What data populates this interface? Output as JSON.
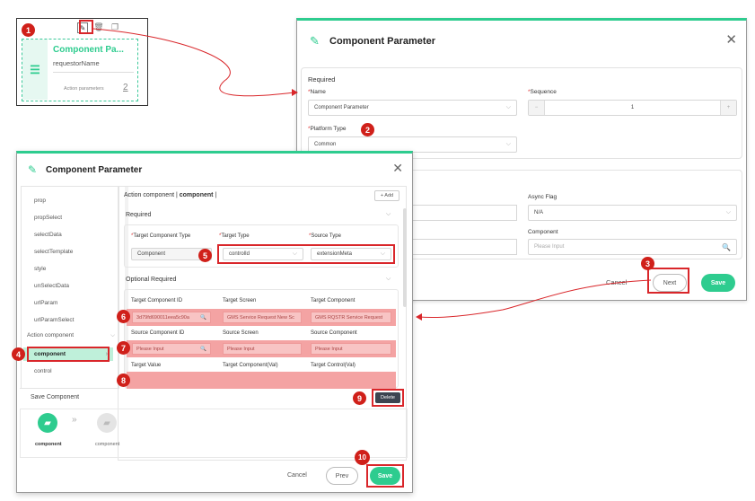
{
  "node_card": {
    "title": "Component Pa...",
    "subtitle": "requestorName",
    "footer": "Action parameters",
    "count": "2"
  },
  "dialog_back": {
    "title": "Component Parameter",
    "section_required": "Required",
    "name_label": "Name",
    "name_value": "Component Parameter",
    "sequence_label": "Sequence",
    "sequence_value": "1",
    "platform_label": "Platform Type",
    "platform_value": "Common",
    "async_label": "Async Flag",
    "async_value": "N/A",
    "component_label": "Component",
    "component_placeholder": "Please Input",
    "cancel": "Cancel",
    "next": "Next",
    "save": "Save"
  },
  "dialog_front": {
    "title": "Component Parameter",
    "menu": [
      "prop",
      "propSelect",
      "selectData",
      "selectTemplate",
      "style",
      "unSelectData",
      "urlParam",
      "urlParamSelect"
    ],
    "action_group": "Action component",
    "selected_item": "component",
    "control_item": "control",
    "save_component": "Save Component",
    "flow_from": "component",
    "flow_to": "component",
    "header_prefix": "Action component | ",
    "header_name": "component",
    "header_suffix": " |",
    "add": "+ Add",
    "required": "Required",
    "target_component_type_label": "Target Component Type",
    "target_component_type_value": "Component",
    "target_type_label": "Target Type",
    "target_type_value": "controlId",
    "source_type_label": "Source Type",
    "source_type_value": "extensionMeta",
    "optional_required": "Optional Required",
    "col1": "Target Component ID",
    "col2": "Target Screen",
    "col3": "Target Component",
    "row1_c1": "3d79fd690011eea5c90a",
    "row1_c2": "GMS Service Request New Sc",
    "row1_c3": "GMS RQSTR Service Request",
    "col4": "Source Component ID",
    "col5": "Source Screen",
    "col6": "Source Component",
    "row2_ph": "Please Input",
    "col7": "Target Value",
    "col8": "Target Component(Val)",
    "col9": "Target Control(Val)",
    "delete": "Delete",
    "cancel": "Cancel",
    "prev": "Prev",
    "save": "Save"
  },
  "badges": [
    "1",
    "2",
    "3",
    "4",
    "5",
    "6",
    "7",
    "8",
    "9",
    "10"
  ],
  "colors": {
    "accent": "#2ecc8f",
    "highlight": "#d9262a",
    "pink": "#f4a3a3"
  }
}
